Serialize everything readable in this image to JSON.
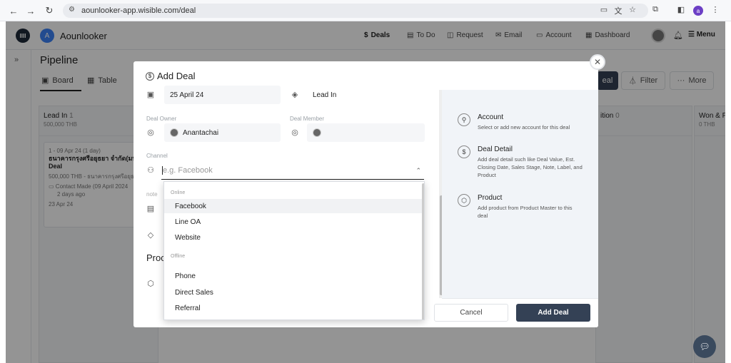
{
  "browser": {
    "url": "aounlooker-app.wisible.com/deal",
    "profile_initial": "a"
  },
  "app": {
    "logo": "IIII",
    "company_initial": "A",
    "company_name": "Aounlooker",
    "user_menu": "Menu"
  },
  "nav": [
    {
      "label": "Deals",
      "icon": "$"
    },
    {
      "label": "To Do",
      "icon": "▤"
    },
    {
      "label": "Request",
      "icon": "◫"
    },
    {
      "label": "Email",
      "icon": "✉"
    },
    {
      "label": "Account",
      "icon": "▭"
    },
    {
      "label": "Dashboard",
      "icon": "▦"
    }
  ],
  "page": {
    "title": "Pipeline",
    "board_tab": "Board",
    "table_tab": "Table",
    "filter": "Filter",
    "more": "More",
    "add_deal": "eal"
  },
  "columns": [
    {
      "name": "Lead In",
      "count": "1",
      "amount": "500,000 THB"
    },
    {
      "name": "ition",
      "count": "0",
      "amount": ""
    },
    {
      "name": "Won & P",
      "count": "",
      "amount": "0 THB"
    }
  ],
  "card": {
    "date": "1 - 09 Apr 24 (1 day)",
    "company": "ธนาคารกรุงศรีอยุธยา จำกัด(มหา",
    "title": "Deal",
    "value": "500,000 THB - ธนาคารกรุงศรีอยุธยา",
    "activity": "Contact Made (09 April 2024",
    "ago": "2 days ago",
    "due": "23 Apr 24"
  },
  "modal": {
    "title": "Add Deal",
    "date_value": "25 April 24",
    "stage_value": "Lead In",
    "owner_label": "Deal Owner",
    "owner_value": "Anantachai",
    "member_label": "Deal Member",
    "channel_label": "Channel",
    "channel_placeholder": "e.g. Facebook",
    "note_label": "note",
    "product_heading": "Proc",
    "cancel": "Cancel",
    "submit": "Add Deal"
  },
  "dropdown": {
    "groups": [
      {
        "label": "Online",
        "options": [
          "Facebook",
          "Line OA",
          "Website"
        ]
      },
      {
        "label": "Offline",
        "options": [
          "Phone",
          "Direct Sales",
          "Referral"
        ]
      }
    ]
  },
  "side_info": [
    {
      "title": "Account",
      "desc": "Select or add new account for this deal",
      "icon": "user-icon"
    },
    {
      "title": "Deal Detail",
      "desc": "Add deal detail such like Deal Value, Est. Closing Date, Sales Stage, Note, Label, and Product",
      "icon": "money-icon"
    },
    {
      "title": "Product",
      "desc": "Add product from Product Master to this deal",
      "icon": "box-icon"
    }
  ]
}
